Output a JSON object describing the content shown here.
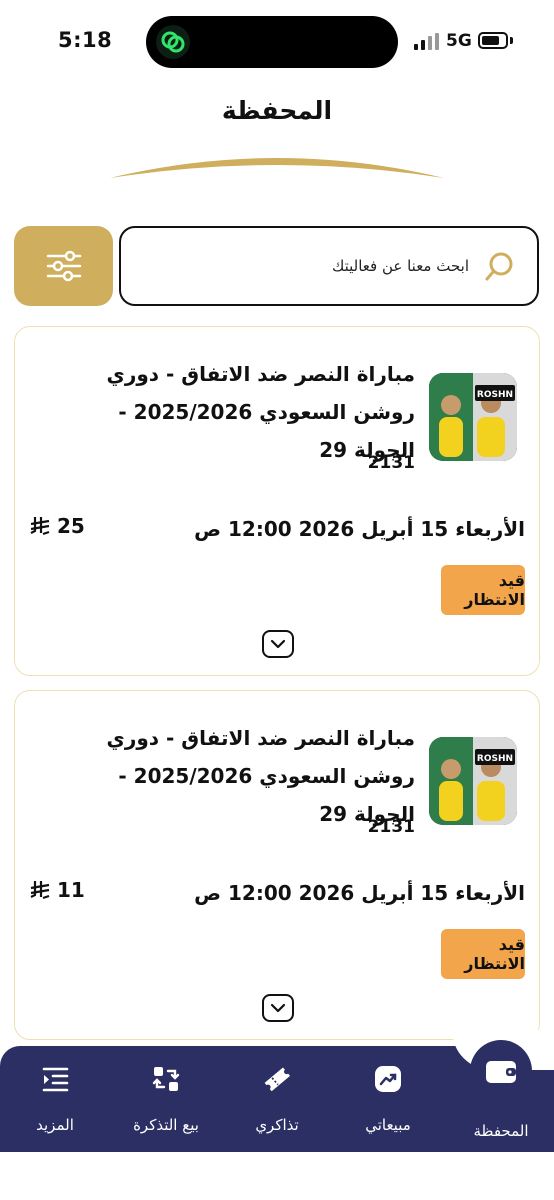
{
  "status_bar": {
    "time": "5:18",
    "network": "5G",
    "battery_level": 0.75
  },
  "header": {
    "title": "المحفظة"
  },
  "search": {
    "placeholder": "ابحث معنا عن فعاليتك",
    "icon": "search-icon",
    "filter_icon": "sliders-icon"
  },
  "colors": {
    "accent_gold": "#cfaf5d",
    "nav_bg": "#2c2f63",
    "badge_orange": "#f2a54a",
    "card_border": "#efe0b4"
  },
  "events": [
    {
      "title": "مباراة النصر ضد الاتفاق - دوري روشن السعودي 2025/2026 - الجولة 29",
      "id": "2131",
      "date": "الأربعاء 15 أبريل 2026 12:00 ص",
      "price": "25",
      "status": "قيد الانتظار",
      "thumb_text": "ROSHN"
    },
    {
      "title": "مباراة النصر ضد الاتفاق - دوري روشن السعودي 2025/2026 - الجولة 29",
      "id": "2131",
      "date": "الأربعاء 15 أبريل 2026 12:00 ص",
      "price": "11",
      "status": "قيد الانتظار",
      "thumb_text": "ROSHN"
    }
  ],
  "nav": {
    "wallet": "المحفظة",
    "my_sales": "مبيعاتي",
    "my_tickets": "تذاكري",
    "sell_ticket": "بيع التذكرة",
    "more": "المزيد"
  }
}
